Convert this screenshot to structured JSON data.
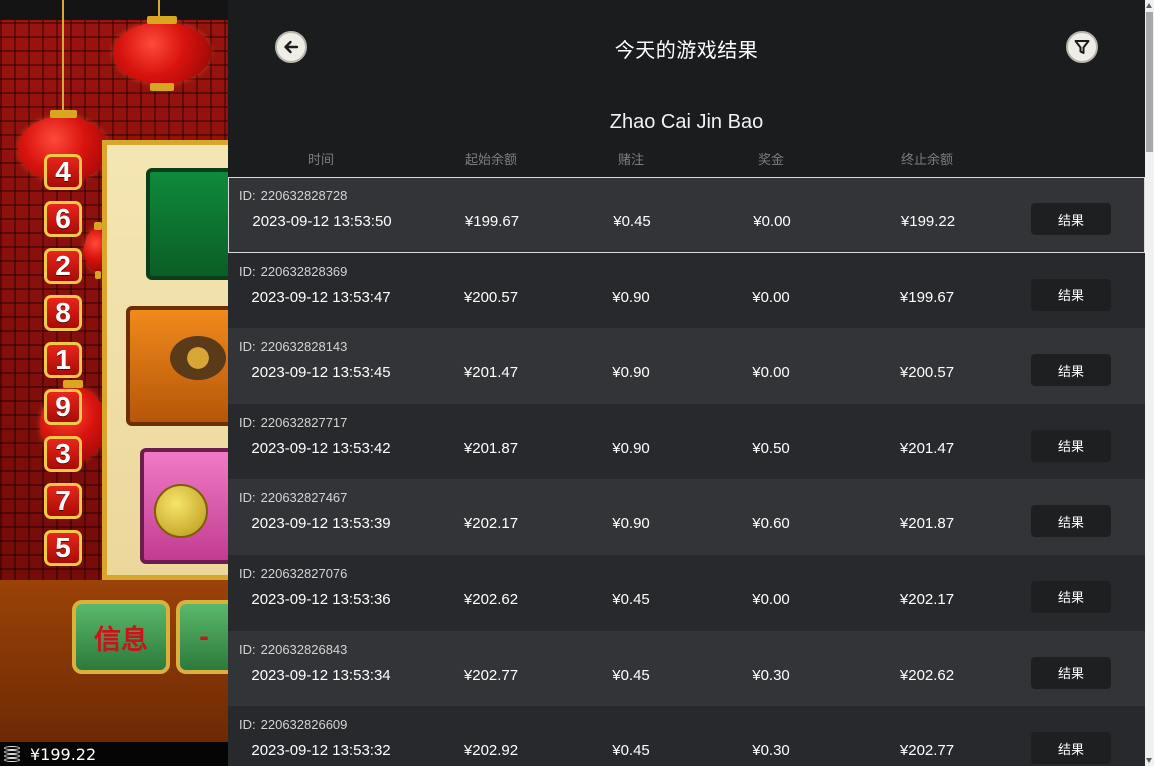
{
  "game_bg": {
    "numbers": [
      "4",
      "6",
      "2",
      "8",
      "1",
      "9",
      "3",
      "7",
      "5"
    ],
    "info_label": "信息",
    "minus_label": "-",
    "balance": "¥199.22"
  },
  "header": {
    "title": "今天的游戏结果",
    "game_name": "Zhao Cai Jin Bao"
  },
  "columns": {
    "time": "时间",
    "start_balance": "起始余额",
    "bet": "赌注",
    "win": "奖金",
    "end_balance": "终止余额"
  },
  "rows": [
    {
      "id_label": "ID:",
      "id": "220632828728",
      "time": "2023-09-12 13:53:50",
      "start": "¥199.67",
      "bet": "¥0.45",
      "win": "¥0.00",
      "end": "¥199.22",
      "button": "结果"
    },
    {
      "id_label": "ID:",
      "id": "220632828369",
      "time": "2023-09-12 13:53:47",
      "start": "¥200.57",
      "bet": "¥0.90",
      "win": "¥0.00",
      "end": "¥199.67",
      "button": "结果"
    },
    {
      "id_label": "ID:",
      "id": "220632828143",
      "time": "2023-09-12 13:53:45",
      "start": "¥201.47",
      "bet": "¥0.90",
      "win": "¥0.00",
      "end": "¥200.57",
      "button": "结果"
    },
    {
      "id_label": "ID:",
      "id": "220632827717",
      "time": "2023-09-12 13:53:42",
      "start": "¥201.87",
      "bet": "¥0.90",
      "win": "¥0.50",
      "end": "¥201.47",
      "button": "结果"
    },
    {
      "id_label": "ID:",
      "id": "220632827467",
      "time": "2023-09-12 13:53:39",
      "start": "¥202.17",
      "bet": "¥0.90",
      "win": "¥0.60",
      "end": "¥201.87",
      "button": "结果"
    },
    {
      "id_label": "ID:",
      "id": "220632827076",
      "time": "2023-09-12 13:53:36",
      "start": "¥202.62",
      "bet": "¥0.45",
      "win": "¥0.00",
      "end": "¥202.17",
      "button": "结果"
    },
    {
      "id_label": "ID:",
      "id": "220632826843",
      "time": "2023-09-12 13:53:34",
      "start": "¥202.77",
      "bet": "¥0.45",
      "win": "¥0.30",
      "end": "¥202.62",
      "button": "结果"
    },
    {
      "id_label": "ID:",
      "id": "220632826609",
      "time": "2023-09-12 13:53:32",
      "start": "¥202.92",
      "bet": "¥0.45",
      "win": "¥0.30",
      "end": "¥202.77",
      "button": "结果"
    }
  ],
  "icons": {
    "back": "arrow-left-icon",
    "filter": "filter-funnel-icon",
    "coins": "coins-stack-icon"
  },
  "colors": {
    "panel_bg": "#1b1c1e",
    "row_odd": "#323437",
    "row_even": "#28292c",
    "button_bg": "#1e1f21",
    "header_text": "#7d7d7d"
  }
}
